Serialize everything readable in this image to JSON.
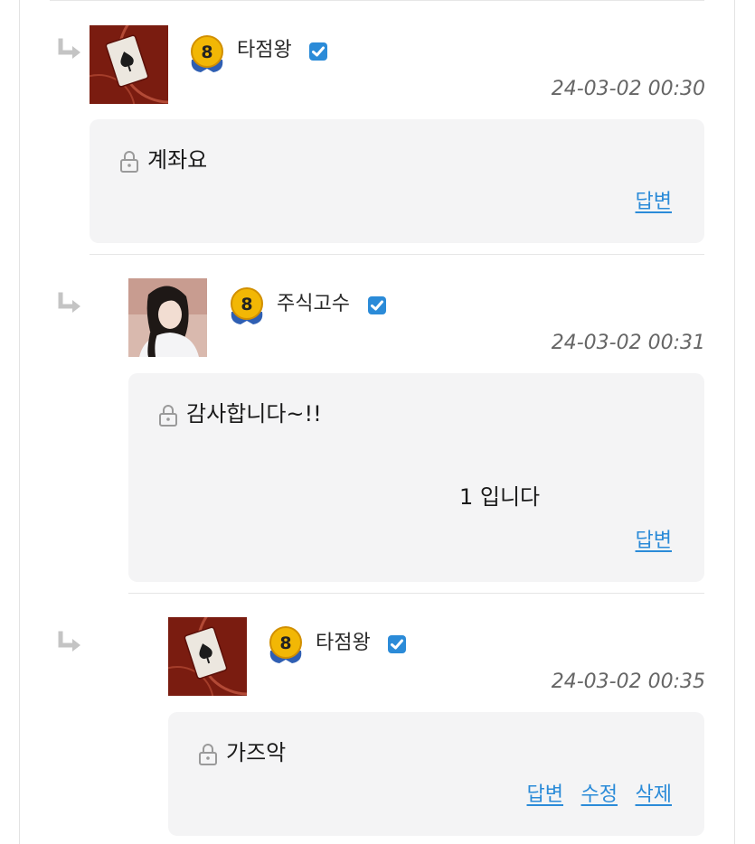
{
  "comments": [
    {
      "author": "타점왕",
      "level": "8",
      "time": "24-03-02 00:30",
      "body": "계좌요",
      "actions": [
        "답변"
      ]
    },
    {
      "author": "주식고수",
      "level": "8",
      "time": "24-03-02 00:31",
      "body": "감사합니다~!!",
      "body_line2": "1 입니다",
      "actions": [
        "답변"
      ]
    },
    {
      "author": "타점왕",
      "level": "8",
      "time": "24-03-02 00:35",
      "body": "가즈악",
      "actions": [
        "답변",
        "수정",
        "삭제"
      ]
    }
  ],
  "colors": {
    "link": "#2b8bd8",
    "verified": "#2b8bd8",
    "bubble": "#f4f4f5",
    "badge_gold": "#f2b705"
  },
  "icons": {
    "reply": "reply-arrow-icon",
    "lock": "lock-icon",
    "verified": "verified-check-icon",
    "level": "level-badge-icon"
  }
}
